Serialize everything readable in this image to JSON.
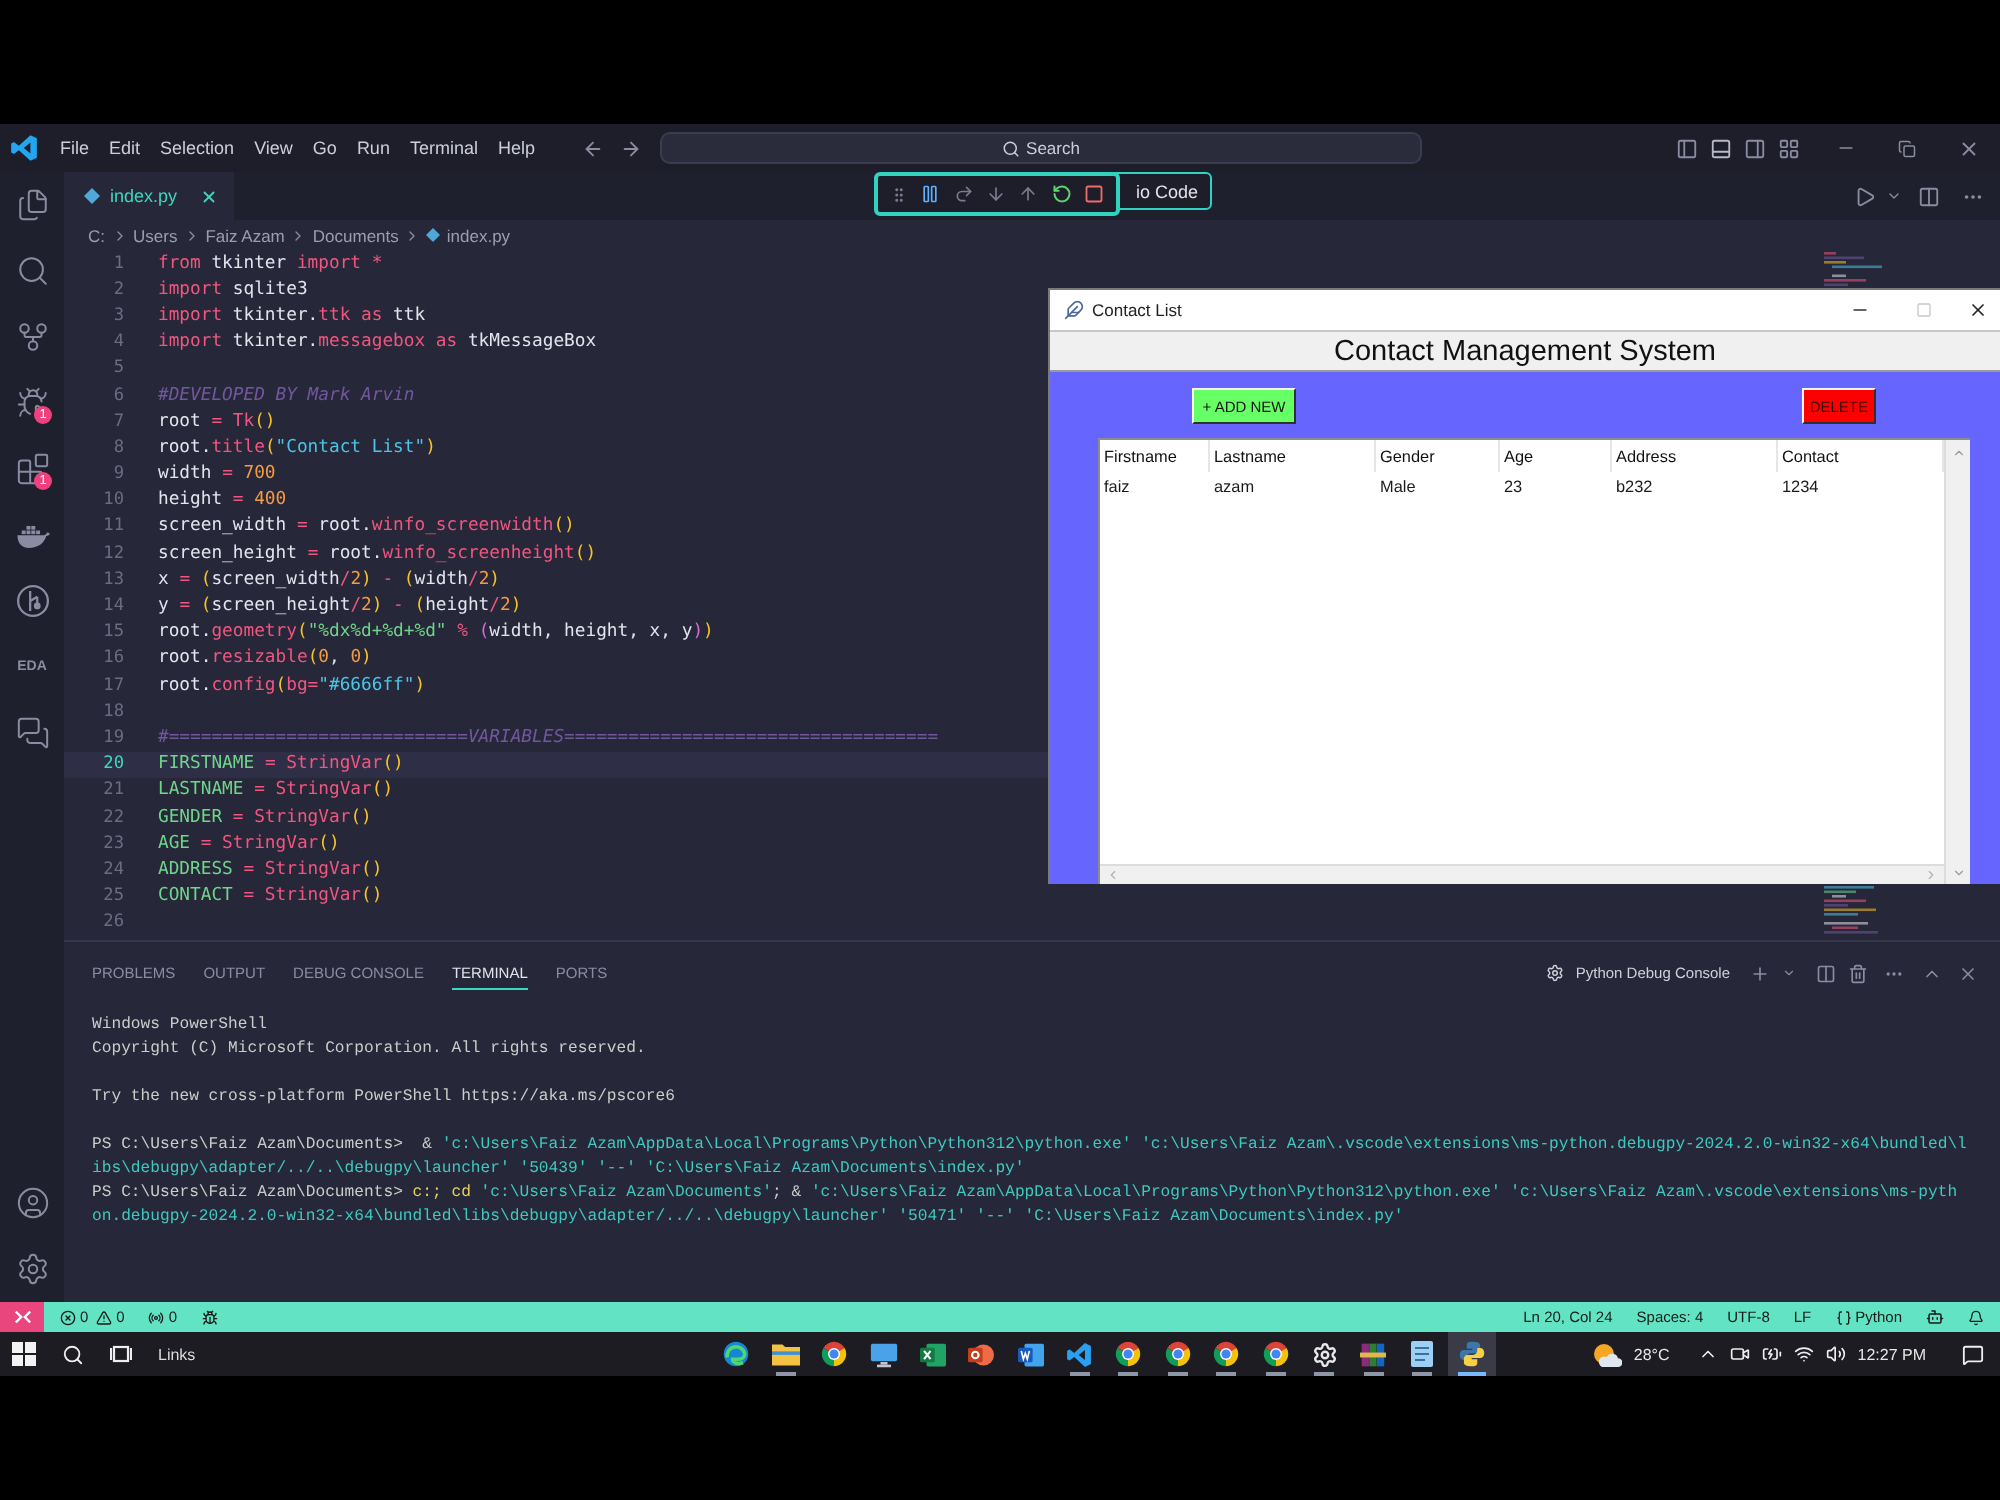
{
  "vscode": {
    "menu": [
      "File",
      "Edit",
      "Selection",
      "View",
      "Go",
      "Run",
      "Terminal",
      "Help"
    ],
    "command_center": "Search",
    "activity_bar": [
      {
        "kind": "explorer"
      },
      {
        "kind": "search"
      },
      {
        "kind": "source-control"
      },
      {
        "kind": "run-debug",
        "badge": "1"
      },
      {
        "kind": "extensions",
        "badge": "1"
      },
      {
        "kind": "docker"
      },
      {
        "kind": "git-graph"
      },
      {
        "kind": "text",
        "label": "EDA"
      },
      {
        "kind": "remote"
      }
    ],
    "activity_bar_bottom": [
      {
        "kind": "account"
      },
      {
        "kind": "settings"
      }
    ],
    "editor_tabs": [
      {
        "label": "index.py",
        "selected": true
      }
    ],
    "window_title": "io Code",
    "breadcrumbs": [
      "C:",
      "Users",
      "Faiz Azam",
      "Documents",
      "index.py"
    ],
    "code_lines": [
      {
        "number": "1",
        "current": false,
        "tokens": [
          {
            "text": "from",
            "kind": "keyword"
          },
          {
            "text": " tkinter ",
            "kind": "name"
          },
          {
            "text": "import *",
            "kind": "keyword"
          }
        ]
      },
      {
        "number": "2",
        "current": false,
        "tokens": [
          {
            "text": "import",
            "kind": "keyword"
          },
          {
            "text": " sqlite3",
            "kind": "name"
          }
        ]
      },
      {
        "number": "3",
        "current": false,
        "tokens": [
          {
            "text": "import",
            "kind": "keyword"
          },
          {
            "text": " tkinter.",
            "kind": "name"
          },
          {
            "text": "ttk",
            "kind": "call"
          },
          {
            "text": " as",
            "kind": "keyword"
          },
          {
            "text": " ttk",
            "kind": "name"
          }
        ]
      },
      {
        "number": "4",
        "current": false,
        "tokens": [
          {
            "text": "import",
            "kind": "keyword"
          },
          {
            "text": " tkinter.",
            "kind": "name"
          },
          {
            "text": "messagebox",
            "kind": "call"
          },
          {
            "text": " as",
            "kind": "keyword"
          },
          {
            "text": " tkMessageBox",
            "kind": "name"
          }
        ]
      },
      {
        "number": "5",
        "current": false
      },
      {
        "number": "6",
        "current": false,
        "tokens": [
          {
            "text": "#DEVELOPED BY Mark Arvin",
            "kind": "comment"
          }
        ]
      },
      {
        "number": "7",
        "current": false,
        "tokens": [
          {
            "text": "root ",
            "kind": "name"
          },
          {
            "text": "= Tk",
            "kind": "call"
          },
          {
            "text": "()",
            "kind": "bracket"
          }
        ]
      },
      {
        "number": "8",
        "current": false,
        "tokens": [
          {
            "text": "root.",
            "kind": "name"
          },
          {
            "text": "title",
            "kind": "call"
          },
          {
            "text": "(",
            "kind": "bracket"
          },
          {
            "text": "\"Contact List\"",
            "kind": "string"
          },
          {
            "text": ")",
            "kind": "bracket"
          }
        ]
      },
      {
        "number": "9",
        "current": false,
        "tokens": [
          {
            "text": "width ",
            "kind": "name"
          },
          {
            "text": "= ",
            "kind": "operator"
          },
          {
            "text": "700",
            "kind": "number"
          }
        ]
      },
      {
        "number": "10",
        "current": false,
        "tokens": [
          {
            "text": "height ",
            "kind": "name"
          },
          {
            "text": "= ",
            "kind": "operator"
          },
          {
            "text": "400",
            "kind": "number"
          }
        ]
      },
      {
        "number": "11",
        "current": false,
        "tokens": [
          {
            "text": "screen_width ",
            "kind": "name"
          },
          {
            "text": "= ",
            "kind": "operator"
          },
          {
            "text": "root.",
            "kind": "name"
          },
          {
            "text": "winfo_screenwidth",
            "kind": "call"
          },
          {
            "text": "()",
            "kind": "bracket"
          }
        ]
      },
      {
        "number": "12",
        "current": false,
        "tokens": [
          {
            "text": "screen_height ",
            "kind": "name"
          },
          {
            "text": "= ",
            "kind": "operator"
          },
          {
            "text": "root.",
            "kind": "name"
          },
          {
            "text": "winfo_screenheight",
            "kind": "call"
          },
          {
            "text": "()",
            "kind": "bracket"
          }
        ]
      },
      {
        "number": "13",
        "current": false,
        "tokens": [
          {
            "text": "x ",
            "kind": "name"
          },
          {
            "text": "= ",
            "kind": "operator"
          },
          {
            "text": "(",
            "kind": "bracket"
          },
          {
            "text": "screen_width",
            "kind": "name"
          },
          {
            "text": "/",
            "kind": "operator"
          },
          {
            "text": "2",
            "kind": "number"
          },
          {
            "text": ")",
            "kind": "bracket"
          },
          {
            "text": " - ",
            "kind": "operator"
          },
          {
            "text": "(",
            "kind": "bracket"
          },
          {
            "text": "width",
            "kind": "name"
          },
          {
            "text": "/",
            "kind": "operator"
          },
          {
            "text": "2",
            "kind": "number"
          },
          {
            "text": ")",
            "kind": "bracket"
          }
        ]
      },
      {
        "number": "14",
        "current": false,
        "tokens": [
          {
            "text": "y ",
            "kind": "name"
          },
          {
            "text": "= ",
            "kind": "operator"
          },
          {
            "text": "(",
            "kind": "bracket"
          },
          {
            "text": "screen_height",
            "kind": "name"
          },
          {
            "text": "/",
            "kind": "operator"
          },
          {
            "text": "2",
            "kind": "number"
          },
          {
            "text": ")",
            "kind": "bracket"
          },
          {
            "text": " - ",
            "kind": "operator"
          },
          {
            "text": "(",
            "kind": "bracket"
          },
          {
            "text": "height",
            "kind": "name"
          },
          {
            "text": "/",
            "kind": "operator"
          },
          {
            "text": "2",
            "kind": "number"
          },
          {
            "text": ")",
            "kind": "bracket"
          }
        ]
      },
      {
        "number": "15",
        "current": false,
        "tokens": [
          {
            "text": "root.",
            "kind": "name"
          },
          {
            "text": "geometry",
            "kind": "call"
          },
          {
            "text": "(",
            "kind": "bracket"
          },
          {
            "text": "\"%dx%d+%d+%d\"",
            "kind": "format"
          },
          {
            "text": " % ",
            "kind": "operator"
          },
          {
            "text": "(",
            "kind": "bracket2"
          },
          {
            "text": "width, height, x, y",
            "kind": "name"
          },
          {
            "text": ")",
            "kind": "bracket2"
          },
          {
            "text": ")",
            "kind": "bracket"
          }
        ]
      },
      {
        "number": "16",
        "current": false,
        "tokens": [
          {
            "text": "root.",
            "kind": "name"
          },
          {
            "text": "resizable",
            "kind": "call"
          },
          {
            "text": "(",
            "kind": "bracket"
          },
          {
            "text": "0",
            "kind": "number"
          },
          {
            "text": ", ",
            "kind": "name"
          },
          {
            "text": "0",
            "kind": "number"
          },
          {
            "text": ")",
            "kind": "bracket"
          }
        ]
      },
      {
        "number": "17",
        "current": false,
        "tokens": [
          {
            "text": "root.",
            "kind": "name"
          },
          {
            "text": "config",
            "kind": "call"
          },
          {
            "text": "(",
            "kind": "bracket"
          },
          {
            "text": "bg=",
            "kind": "operator"
          },
          {
            "text": "\"#6666ff\"",
            "kind": "string"
          },
          {
            "text": ")",
            "kind": "bracket"
          }
        ]
      },
      {
        "number": "18",
        "current": false
      },
      {
        "number": "19",
        "current": false,
        "tokens": [
          {
            "text": "#============================VARIABLES===================================",
            "kind": "comment"
          }
        ]
      },
      {
        "number": "20",
        "current": true,
        "tokens": [
          {
            "text": "FIRSTNAME ",
            "kind": "constant"
          },
          {
            "text": "= StringVar",
            "kind": "call"
          },
          {
            "text": "()",
            "kind": "bracket"
          }
        ]
      },
      {
        "number": "21",
        "current": false,
        "tokens": [
          {
            "text": "LASTNAME ",
            "kind": "constant"
          },
          {
            "text": "= StringVar",
            "kind": "call"
          },
          {
            "text": "()",
            "kind": "bracket"
          }
        ]
      },
      {
        "number": "22",
        "current": false,
        "tokens": [
          {
            "text": "GENDER ",
            "kind": "constant"
          },
          {
            "text": "= StringVar",
            "kind": "call"
          },
          {
            "text": "()",
            "kind": "bracket"
          }
        ]
      },
      {
        "number": "23",
        "current": false,
        "tokens": [
          {
            "text": "AGE ",
            "kind": "constant"
          },
          {
            "text": "= StringVar",
            "kind": "call"
          },
          {
            "text": "()",
            "kind": "bracket"
          }
        ]
      },
      {
        "number": "24",
        "current": false,
        "tokens": [
          {
            "text": "ADDRESS ",
            "kind": "constant"
          },
          {
            "text": "= StringVar",
            "kind": "call"
          },
          {
            "text": "()",
            "kind": "bracket"
          }
        ]
      },
      {
        "number": "25",
        "current": false,
        "tokens": [
          {
            "text": "CONTACT ",
            "kind": "constant"
          },
          {
            "text": "= StringVar",
            "kind": "call"
          },
          {
            "text": "()",
            "kind": "bracket"
          }
        ]
      },
      {
        "number": "26",
        "current": false
      }
    ]
  },
  "tk_window": {
    "title": "Contact List",
    "heading": "Contact Management System",
    "buttons": [
      {
        "kind": "add",
        "label": "+ ADD NEW"
      },
      {
        "kind": "delete",
        "label": "DELETE"
      }
    ],
    "table": {
      "columns": [
        "Firstname",
        "Lastname",
        "Gender",
        "Age",
        "Address",
        "Contact"
      ],
      "rows": [
        [
          "faiz",
          "azam",
          "Male",
          "23",
          "b232",
          "1234"
        ]
      ]
    }
  },
  "panel": {
    "tabs": [
      {
        "label": "PROBLEMS",
        "selected": false
      },
      {
        "label": "OUTPUT",
        "selected": false
      },
      {
        "label": "DEBUG CONSOLE",
        "selected": false
      },
      {
        "label": "TERMINAL",
        "selected": true
      },
      {
        "label": "PORTS",
        "selected": false
      }
    ],
    "terminal_name": "Python Debug Console",
    "blocks": [
      {
        "lines": [
          [
            {
              "text": "Windows PowerShell",
              "kind": "plain"
            }
          ],
          [
            {
              "text": "Copyright (C) Microsoft Corporation. All rights reserved.",
              "kind": "plain"
            }
          ]
        ]
      },
      {
        "lines": [
          [
            {
              "text": "Try the new cross-platform PowerShell https://aka.ms/pscore6",
              "kind": "plain"
            }
          ]
        ]
      },
      {
        "lines": [
          [
            {
              "text": "PS C:\\Users\\Faiz Azam\\Documents>  & ",
              "kind": "plain"
            },
            {
              "text": "'c:\\Users\\Faiz Azam\\AppData\\Local\\Programs\\Python\\Python312\\python.exe' 'c:\\Users\\Faiz Azam\\.vscode\\extensions\\ms-python.debugpy-2024.2.0-win32-x64\\bundled\\l",
              "kind": "string"
            }
          ],
          [
            {
              "text": "ibs\\debugpy\\adapter/../..\\debugpy\\launcher' '50439' '--' 'C:\\Users\\Faiz Azam\\Documents\\index.py'",
              "kind": "string"
            }
          ],
          [
            {
              "text": "PS C:\\Users\\Faiz Azam\\Documents> ",
              "kind": "plain"
            },
            {
              "text": "c:; cd ",
              "kind": "command"
            },
            {
              "text": "'c:\\Users\\Faiz Azam\\Documents'",
              "kind": "string"
            },
            {
              "text": "; & ",
              "kind": "plain"
            },
            {
              "text": "'c:\\Users\\Faiz Azam\\AppData\\Local\\Programs\\Python\\Python312\\python.exe' 'c:\\Users\\Faiz Azam\\.vscode\\extensions\\ms-pyth",
              "kind": "string"
            }
          ],
          [
            {
              "text": "on.debugpy-2024.2.0-win32-x64\\bundled\\libs\\debugpy\\adapter/../..\\debugpy\\launcher' '50471' '--' 'C:\\Users\\Faiz Azam\\Documents\\index.py'",
              "kind": "string"
            }
          ]
        ]
      }
    ]
  },
  "status_bar": {
    "errors": "0",
    "warnings": "0",
    "ports": "0",
    "items": [
      "Ln 20, Col 24",
      "Spaces: 4",
      "UTF-8",
      "LF"
    ],
    "language": "Python"
  },
  "taskbar": {
    "links": "Links",
    "apps": [
      {
        "kind": "edge",
        "running": false,
        "selected": false
      },
      {
        "kind": "explorer",
        "running": true,
        "selected": false
      },
      {
        "kind": "chrome",
        "running": false,
        "selected": false
      },
      {
        "kind": "remote-desktop",
        "running": false,
        "selected": false
      },
      {
        "kind": "excel",
        "running": false,
        "selected": false
      },
      {
        "kind": "powerpoint",
        "running": false,
        "selected": false
      },
      {
        "kind": "word",
        "running": false,
        "selected": false
      },
      {
        "kind": "vscode",
        "running": true,
        "selected": false
      },
      {
        "kind": "chrome",
        "running": true,
        "selected": false
      },
      {
        "kind": "chrome",
        "running": true,
        "selected": false
      },
      {
        "kind": "chrome",
        "running": true,
        "selected": false
      },
      {
        "kind": "chrome",
        "running": true,
        "selected": false
      },
      {
        "kind": "settings",
        "running": true,
        "selected": false
      },
      {
        "kind": "winrar",
        "running": true,
        "selected": false
      },
      {
        "kind": "notepad",
        "running": true,
        "selected": false
      },
      {
        "kind": "python",
        "running": true,
        "selected": true
      }
    ],
    "temperature": "28°C",
    "time": "12:27 PM"
  }
}
